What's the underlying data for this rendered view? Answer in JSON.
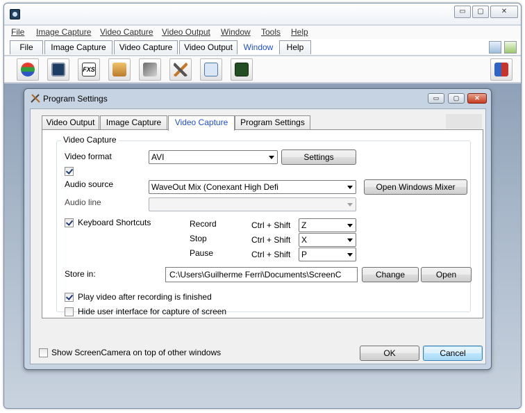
{
  "menubar": [
    "File",
    "Image Capture",
    "Video Capture",
    "Video Output",
    "Window",
    "Tools",
    "Help"
  ],
  "app_tabs": [
    "File",
    "Image Capture",
    "Video Capture",
    "Video Output",
    "Window",
    "Help"
  ],
  "app_tab_active": "Window",
  "window_buttons": {
    "minimize": "▭",
    "maximize": "▢",
    "close": "✕"
  },
  "toolbar_icons": [
    "layers-icon",
    "monitor-icon",
    "fxs-effects-icon",
    "image-capture-icon",
    "video-capture-icon",
    "tools-icon",
    "windows-icon",
    "audio-meter-icon"
  ],
  "toolbar_exit_icon": "exit-door-icon",
  "dialog": {
    "title": "Program Settings",
    "tabs": [
      "Video Output",
      "Image Capture",
      "Video Capture",
      "Program Settings"
    ],
    "active_tab": "Video Capture",
    "group_title": "Video Capture",
    "video_format_label": "Video format",
    "video_format_value": "AVI",
    "settings_button": "Settings",
    "audio_checkbox_checked": true,
    "audio_source_label": "Audio source",
    "audio_source_value": "WaveOut Mix (Conexant High Defi",
    "open_mixer_button": "Open Windows Mixer",
    "audio_line_label": "Audio line",
    "audio_line_value": "",
    "keyboard_shortcuts_label": "Keyboard Shortcuts",
    "keyboard_shortcuts_checked": true,
    "shortcuts": [
      {
        "action": "Record",
        "modifier": "Ctrl + Shift",
        "key": "Z"
      },
      {
        "action": "Stop",
        "modifier": "Ctrl + Shift",
        "key": "X"
      },
      {
        "action": "Pause",
        "modifier": "Ctrl + Shift",
        "key": "P"
      }
    ],
    "store_in_label": "Store in:",
    "store_in_path": "C:\\Users\\Guilherme Ferri\\Documents\\ScreenC",
    "change_button": "Change",
    "open_button": "Open",
    "play_after_label": "Play video after recording is finished",
    "play_after_checked": true,
    "hide_ui_label": "Hide user interface for capture of screen",
    "hide_ui_checked": false,
    "on_top_label": "Show ScreenCamera on top of other windows",
    "on_top_checked": false,
    "ok_button": "OK",
    "cancel_button": "Cancel"
  }
}
